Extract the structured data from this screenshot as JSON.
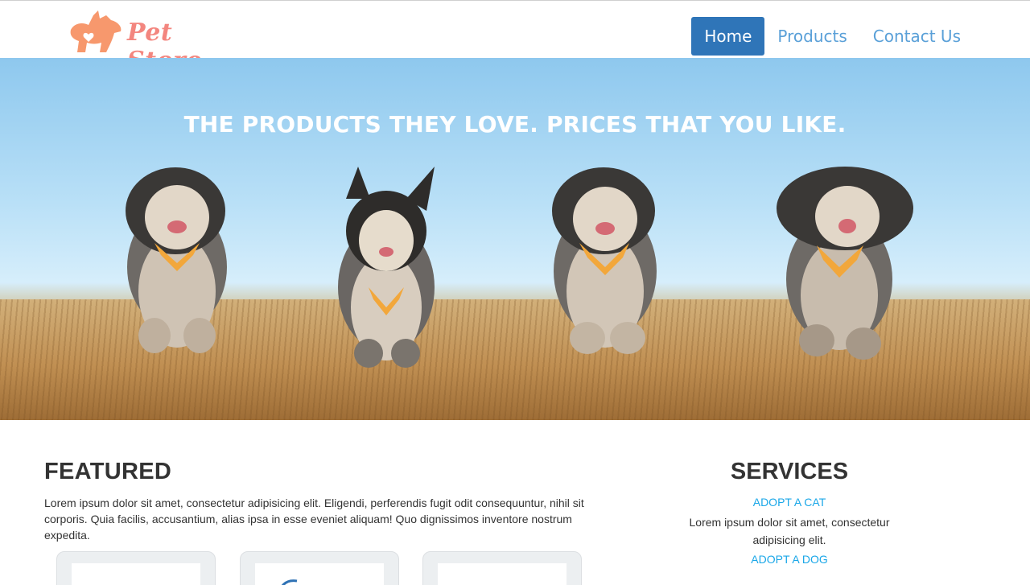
{
  "brand": {
    "name": "Pet Store",
    "logo_icon": "dog-heart-logo-icon",
    "color": "#f3867f"
  },
  "nav": {
    "items": [
      {
        "label": "Home",
        "active": true
      },
      {
        "label": "Products",
        "active": false
      },
      {
        "label": "Contact Us",
        "active": false
      }
    ],
    "active_color": "#2f75b8",
    "link_color": "#5aa0d8"
  },
  "hero": {
    "title": "THE PRODUCTS THEY LOVE. PRICES THAT YOU LIKE."
  },
  "featured": {
    "heading": "FEATURED",
    "body": "Lorem ipsum dolor sit amet, consectetur adipisicing elit. Eligendi, perferendis fugit odit consequuntur, nihil sit corporis. Quia facilis, accusantium, alias ipsa in esse eveniet aliquam! Quo dignissimos inventore nostrum expedita."
  },
  "services": {
    "heading": "SERVICES",
    "items": [
      {
        "link": "ADOPT A CAT",
        "description": "Lorem ipsum dolor sit amet, consectetur adipisicing elit."
      },
      {
        "link": "ADOPT A DOG"
      }
    ],
    "link_color": "#1aa7e8"
  }
}
